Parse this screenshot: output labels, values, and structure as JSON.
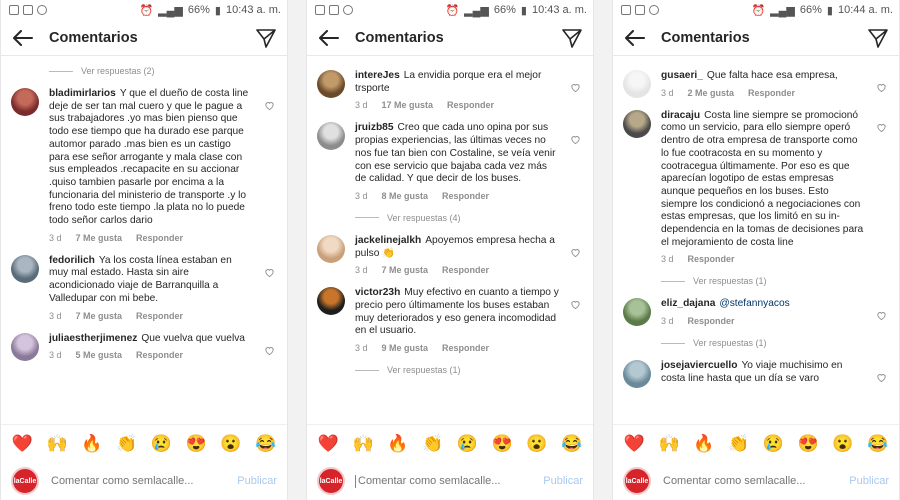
{
  "panes": [
    {
      "status": {
        "battery": "66%",
        "time": "10:43 a. m."
      },
      "title": "Comentarios",
      "top_replies": "Ver respuestas (2)",
      "comments": [
        {
          "user": "bladimirlarios",
          "text": "Y que el dueño de costa line deje de ser tan mal cuero y que le pague a sus trabajadores .yo mas bien pienso que todo ese tiempo que ha durado ese parque automor parado .mas bien es un castigo para ese señor arrogante y mala clase con sus empleados .recapacite en su accionar .quiso tambien pasarle por encima a la funcionaria del ministerio de transporte .y lo freno todo este tiempo .la plata no lo puede todo señor carlos dario",
          "age": "3 d",
          "likes": "7 Me gusta",
          "reply": "Responder"
        },
        {
          "user": "fedorilich",
          "text": "Ya los costa línea estaban en muy mal estado. Hasta sin aire acondicionado viaje de Barranquilla a Valledupar con mi bebe.",
          "age": "3 d",
          "likes": "7 Me gusta",
          "reply": "Responder"
        },
        {
          "user": "juliaestherjimenez",
          "text": "Que vuelva que vuelva",
          "age": "3 d",
          "likes": "5 Me gusta",
          "reply": "Responder"
        }
      ],
      "composer": {
        "placeholder": "Comentar como semlacalle...",
        "publish": "Publicar"
      }
    },
    {
      "status": {
        "battery": "66%",
        "time": "10:43 a. m."
      },
      "title": "Comentarios",
      "comments": [
        {
          "user": "intereJes",
          "text": "La envidia porque era el mejor trsporte",
          "age": "3 d",
          "likes": "17 Me gusta",
          "reply": "Responder"
        },
        {
          "user": "jruizb85",
          "text": "Creo que cada uno opina por sus propias experiencias, las últimas veces no nos fue tan bien con Costaline, se veía venir con ese servicio que bajaba cada vez más de calidad. Y que decir de los buses.",
          "age": "3 d",
          "likes": "8 Me gusta",
          "reply": "Responder",
          "replies": "Ver respuestas (4)"
        },
        {
          "user": "jackelinejalkh",
          "text": "Apoyemos empresa hecha a pulso 👏",
          "age": "3 d",
          "likes": "7 Me gusta",
          "reply": "Responder"
        },
        {
          "user": "victor23h",
          "text": "Muy efectivo en cuanto a tiempo y precio pero últimamente los buses estaban muy deteriorados y eso genera incomodidad en el usuario.",
          "age": "3 d",
          "likes": "9 Me gusta",
          "reply": "Responder",
          "replies": "Ver respuestas (1)"
        }
      ],
      "composer": {
        "placeholder": "Comentar como semlacalle...",
        "publish": "Publicar"
      }
    },
    {
      "status": {
        "battery": "66%",
        "time": "10:44 a. m."
      },
      "title": "Comentarios",
      "comments": [
        {
          "user": "gusaeri_",
          "text": "Que falta hace esa empresa,",
          "age": "3 d",
          "likes": "2 Me gusta",
          "reply": "Responder"
        },
        {
          "user": "diracaju",
          "text": "Costa line siempre se promocionó como un servicio, para ello siempre operó dentro de otra empresa de transporte como lo fue cootracosta en su momento y cootracegua últimamente. Por eso es que aparecían logotipo de estas empresas aunque pequeños en los buses. Esto siempre los condicionó a negociaciones con estas empresas, que los limitó en su in-dependencia en la tomas de decisiones para el mejoramiento de costa line",
          "age": "3 d",
          "likes": "",
          "reply": "Responder",
          "replies": "Ver respuestas (1)"
        },
        {
          "user": "eliz_dajana",
          "mention": "@stefannyacos",
          "text": "",
          "age": "3 d",
          "likes": "",
          "reply": "Responder",
          "replies": "Ver respuestas (1)"
        },
        {
          "user": "josejaviercuello",
          "text": "Yo viaje muchisimo en costa line hasta que un día se varo",
          "age": "",
          "likes": "",
          "reply": ""
        }
      ],
      "composer": {
        "placeholder": "Comentar como semlacalle...",
        "publish": "Publicar"
      }
    }
  ],
  "reactions": [
    "❤️",
    "🙌",
    "🔥",
    "👏",
    "😢",
    "😍",
    "😮",
    "😂"
  ],
  "avatar_text": "laCalle",
  "colors": {
    "accent": "#3897f0",
    "brand": "#d6242b"
  }
}
